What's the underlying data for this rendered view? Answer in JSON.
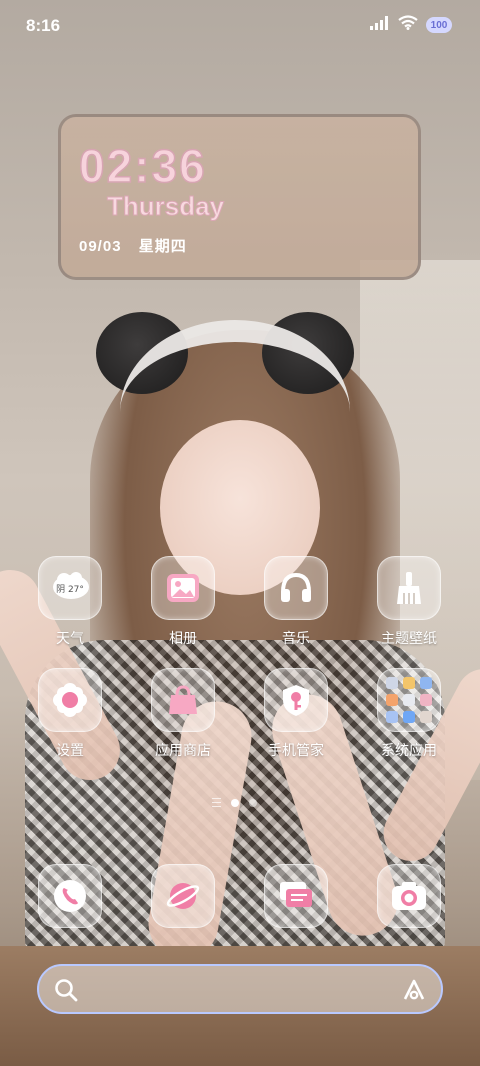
{
  "status_bar": {
    "time": "8:16",
    "battery": "100"
  },
  "clock_widget": {
    "time": "02:36",
    "day": "Thursday",
    "date": "09/03",
    "weekday": "星期四"
  },
  "home_row1": [
    {
      "label": "天气",
      "icon": "weather-icon",
      "icon_text": "阴 27°"
    },
    {
      "label": "相册",
      "icon": "gallery-icon"
    },
    {
      "label": "音乐",
      "icon": "headphones-icon"
    },
    {
      "label": "主题壁纸",
      "icon": "brush-icon"
    }
  ],
  "home_row2": [
    {
      "label": "设置",
      "icon": "settings-flower-icon"
    },
    {
      "label": "应用商店",
      "icon": "shopping-bag-icon"
    },
    {
      "label": "手机管家",
      "icon": "shield-key-icon"
    },
    {
      "label": "系统应用",
      "icon": "folder-icon"
    }
  ],
  "dock": [
    {
      "icon": "phone-icon"
    },
    {
      "icon": "browser-planet-icon"
    },
    {
      "icon": "messages-icon"
    },
    {
      "icon": "camera-icon"
    }
  ],
  "colors": {
    "accent_pink": "#f08fb0",
    "search_border": "#b9c9ff"
  }
}
